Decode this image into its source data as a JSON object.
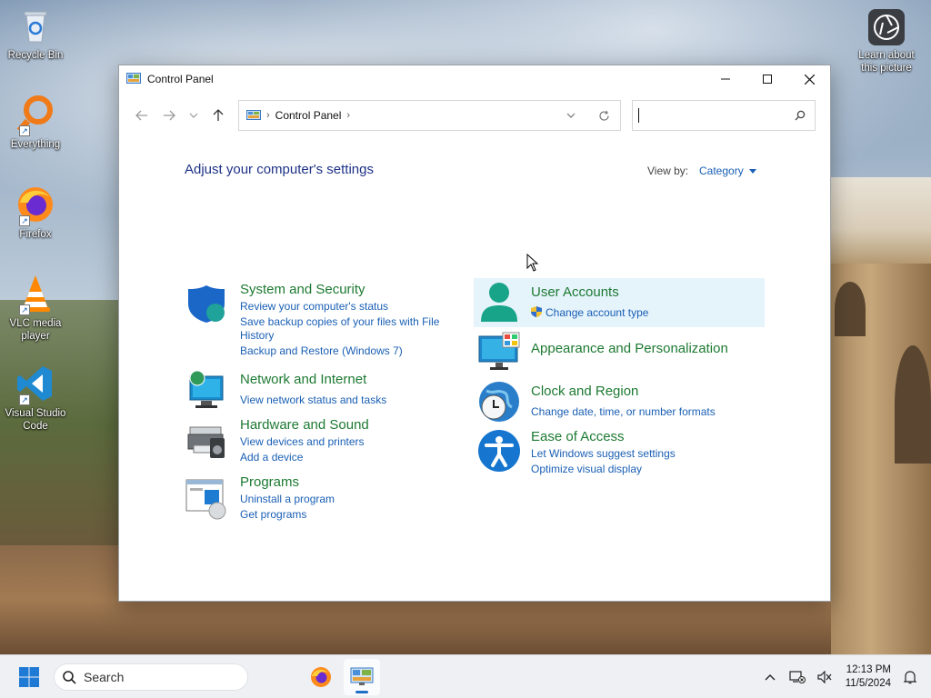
{
  "desktop": {
    "icons": [
      {
        "label": "Recycle Bin",
        "icon": "recycle-bin-icon"
      },
      {
        "label": "Everything",
        "icon": "everything-search-icon"
      },
      {
        "label": "Firefox",
        "icon": "firefox-icon"
      },
      {
        "label": "VLC media player",
        "icon": "vlc-icon"
      },
      {
        "label": "Visual Studio Code",
        "icon": "vscode-icon"
      }
    ],
    "learn_picture": {
      "label": "Learn about this picture",
      "icon": "camera-lens-icon"
    }
  },
  "window": {
    "title": "Control Panel",
    "breadcrumb": "Control Panel",
    "search_value": "",
    "heading": "Adjust your computer's settings",
    "view_by_label": "View by:",
    "view_by_value": "Category",
    "categories": [
      {
        "title": "System and Security",
        "icon": "shield-icon",
        "links": [
          "Review your computer's status",
          "Save backup copies of your files with File",
          "History",
          "Backup and Restore (Windows 7)"
        ]
      },
      {
        "title": "Network and Internet",
        "icon": "network-globe-icon",
        "links": [
          "View network status and tasks"
        ]
      },
      {
        "title": "Hardware and Sound",
        "icon": "printer-speaker-icon",
        "links": [
          "View devices and printers",
          "Add a device"
        ]
      },
      {
        "title": "Programs",
        "icon": "programs-icon",
        "links": [
          "Uninstall a program",
          "Get programs"
        ]
      },
      {
        "title": "User Accounts",
        "icon": "user-icon",
        "links": [
          "Change account type"
        ]
      },
      {
        "title": "Appearance and Personalization",
        "icon": "monitor-palette-icon",
        "links": []
      },
      {
        "title": "Clock and Region",
        "icon": "clock-globe-icon",
        "links": [
          "Change date, time, or number formats"
        ]
      },
      {
        "title": "Ease of Access",
        "icon": "accessibility-icon",
        "links": [
          "Let Windows suggest settings",
          "Optimize visual display"
        ]
      }
    ]
  },
  "taskbar": {
    "search_placeholder": "Search",
    "apps": [
      "firefox-icon",
      "control-panel-icon"
    ],
    "time": "12:13 PM",
    "date": "11/5/2024"
  },
  "colors": {
    "link": "#1a5fb4",
    "category_title": "#1d7a32",
    "heading": "#1e3287",
    "hover_bg": "#e5f3fb"
  }
}
